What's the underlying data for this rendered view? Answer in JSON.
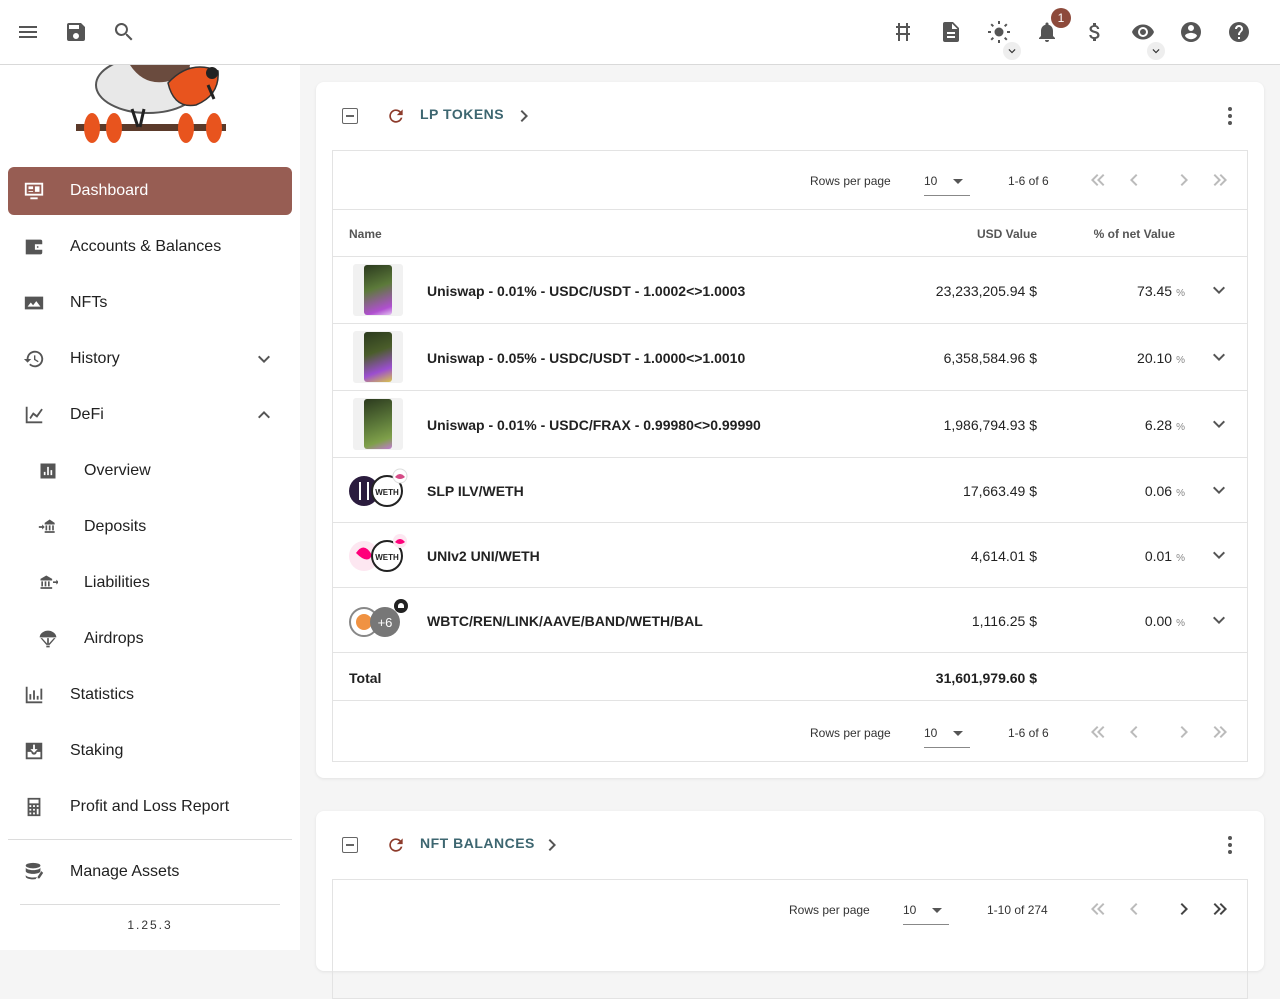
{
  "notifications": {
    "count": "1"
  },
  "sidebar": {
    "items": [
      {
        "label": "Dashboard",
        "icon": "dashboard-icon"
      },
      {
        "label": "Accounts & Balances",
        "icon": "wallet-icon"
      },
      {
        "label": "NFTs",
        "icon": "image-icon"
      },
      {
        "label": "History",
        "icon": "history-icon"
      },
      {
        "label": "DeFi",
        "icon": "defi-chart-icon"
      },
      {
        "label": "Overview",
        "icon": "bar-chart-icon"
      },
      {
        "label": "Deposits",
        "icon": "deposit-icon"
      },
      {
        "label": "Liabilities",
        "icon": "bank-icon"
      },
      {
        "label": "Airdrops",
        "icon": "parachute-icon"
      },
      {
        "label": "Statistics",
        "icon": "statistics-icon"
      },
      {
        "label": "Staking",
        "icon": "staking-icon"
      },
      {
        "label": "Profit and Loss Report",
        "icon": "calculator-icon"
      },
      {
        "label": "Manage Assets",
        "icon": "database-icon"
      }
    ],
    "version": "1.25.3"
  },
  "lp_tokens": {
    "title": "LP TOKENS",
    "pager": {
      "rows_label": "Rows per page",
      "rows_value": "10",
      "range": "1-6 of 6"
    },
    "columns": {
      "name": "Name",
      "usd": "USD Value",
      "pct": "% of net Value"
    },
    "rows": [
      {
        "name": "Uniswap - 0.01% - USDC/USDT - 1.0002<>1.0003",
        "usd": "23,233,205.94 $",
        "pct": "73.45"
      },
      {
        "name": "Uniswap - 0.05% - USDC/USDT - 1.0000<>1.0010",
        "usd": "6,358,584.96 $",
        "pct": "20.10"
      },
      {
        "name": "Uniswap - 0.01% - USDC/FRAX - 0.99980<>0.99990",
        "usd": "1,986,794.93 $",
        "pct": "6.28"
      },
      {
        "name": "SLP ILV/WETH",
        "usd": "17,663.49 $",
        "pct": "0.06"
      },
      {
        "name": "UNIv2 UNI/WETH",
        "usd": "4,614.01 $",
        "pct": "0.01"
      },
      {
        "name": "WBTC/REN/LINK/AAVE/BAND/WETH/BAL",
        "usd": "1,116.25 $",
        "pct": "0.00"
      }
    ],
    "pct_symbol": "%",
    "total_label": "Total",
    "total_value": "31,601,979.60 $",
    "token_labels": {
      "weth": "WETH",
      "more": "+6"
    }
  },
  "nft_balances": {
    "title": "NFT BALANCES",
    "pager": {
      "rows_label": "Rows per page",
      "rows_value": "10",
      "range": "1-10 of 274"
    }
  },
  "colors": {
    "accent": "#975d53",
    "title": "#3d6670",
    "badge": "#8d4a3b"
  }
}
